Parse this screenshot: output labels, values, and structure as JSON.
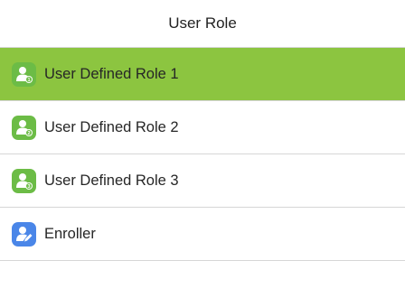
{
  "header": {
    "title": "User Role"
  },
  "roles": [
    {
      "label": "User Defined Role 1",
      "badge": "1",
      "icon": "user-role-1-icon",
      "selected": true
    },
    {
      "label": "User Defined Role 2",
      "badge": "2",
      "icon": "user-role-2-icon",
      "selected": false
    },
    {
      "label": "User Defined Role 3",
      "badge": "3",
      "icon": "user-role-3-icon",
      "selected": false
    },
    {
      "label": "Enroller",
      "badge": "",
      "icon": "enroller-icon",
      "selected": false
    }
  ],
  "colors": {
    "selected_bg": "#8cc540",
    "role_icon_bg": "#6cbc46",
    "enroller_icon_bg": "#4a86e8",
    "divider": "#d6d6d6"
  }
}
